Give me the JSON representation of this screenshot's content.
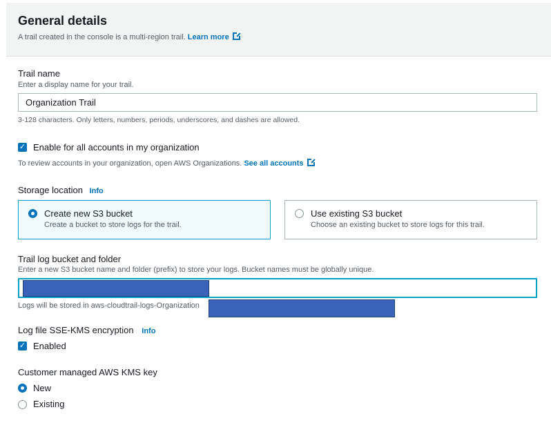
{
  "header": {
    "title": "General details",
    "description": "A trail created in the console is a multi-region trail.",
    "learn_more": "Learn more"
  },
  "trail_name": {
    "label": "Trail name",
    "description": "Enter a display name for your trail.",
    "value": "Organization Trail",
    "hint": "3-128 characters. Only letters, numbers, periods, underscores, and dashes are allowed."
  },
  "org": {
    "label": "Enable for all accounts in my organization",
    "checked": true,
    "description": "To review accounts in your organization, open AWS Organizations.",
    "link": "See all accounts"
  },
  "storage": {
    "label": "Storage location",
    "info": "Info",
    "options": [
      {
        "title": "Create new S3 bucket",
        "description": "Create a bucket to store logs for the trail.",
        "selected": true
      },
      {
        "title": "Use existing S3 bucket",
        "description": "Choose an existing bucket to store logs for this trail.",
        "selected": false
      }
    ]
  },
  "bucket": {
    "label": "Trail log bucket and folder",
    "description": "Enter a new S3 bucket name and folder (prefix) to store your logs. Bucket names must be globally unique.",
    "hint": "Logs will be stored in aws-cloudtrail-logs-Organization"
  },
  "sse": {
    "label": "Log file SSE-KMS encryption",
    "info": "Info",
    "checkbox_label": "Enabled",
    "checked": true
  },
  "kms": {
    "label": "Customer managed AWS KMS key",
    "options": [
      {
        "label": "New",
        "selected": true
      },
      {
        "label": "Existing",
        "selected": false
      }
    ]
  },
  "colors": {
    "accent": "#0073bb",
    "redaction": "#3a62b8"
  }
}
